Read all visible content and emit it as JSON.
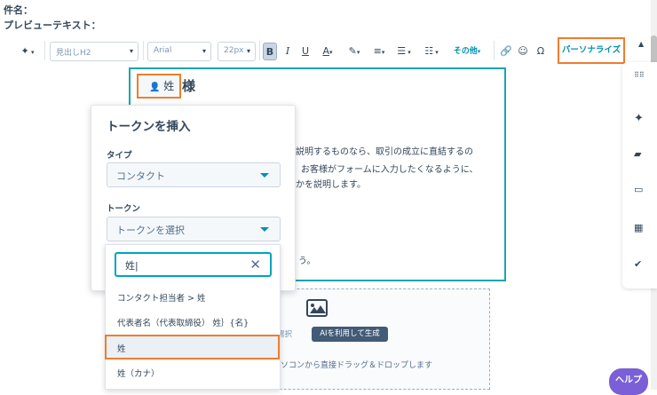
{
  "header": {
    "subject_label": "件名：",
    "preview_label": "プレビューテキスト："
  },
  "toolbar": {
    "ai_icon": "sparkle-icon",
    "style_select": "見出しH2",
    "font_select": "Arial",
    "size_select": "22px",
    "bold": "B",
    "italic": "I",
    "underline": "U",
    "text_color": "A",
    "more_label": "その他",
    "personalize_label": "パーソナライズ"
  },
  "editor": {
    "token_label": "姓",
    "heading_suffix": "様",
    "body_line_1": "を説明するものなら、取引の成立に直結するの",
    "body_line_2": "お客様がフォームに入力したくなるように、",
    "body_line_3": "いかを説明します。",
    "body_line_4": "う。"
  },
  "image_block": {
    "select_label": "選択",
    "ai_generate_label": "AIを利用して生成",
    "drop_hint": "ソコンから直接ドラッグ＆ドロップします"
  },
  "popup": {
    "title": "トークンを挿入",
    "type_label": "タイプ",
    "type_value": "コンタクト",
    "token_label": "トークン",
    "token_placeholder": "トークンを選択",
    "search_value": "姓",
    "options": [
      "コンタクト担当者 > 姓",
      "代表者名（代表取締役） 姓｝{名}",
      "姓",
      "姓（カナ）"
    ]
  },
  "help_label": "ヘルプ",
  "colors": {
    "accent": "#0091ae",
    "highlight": "#ef7d2c",
    "editor_border": "#17a6b0"
  }
}
